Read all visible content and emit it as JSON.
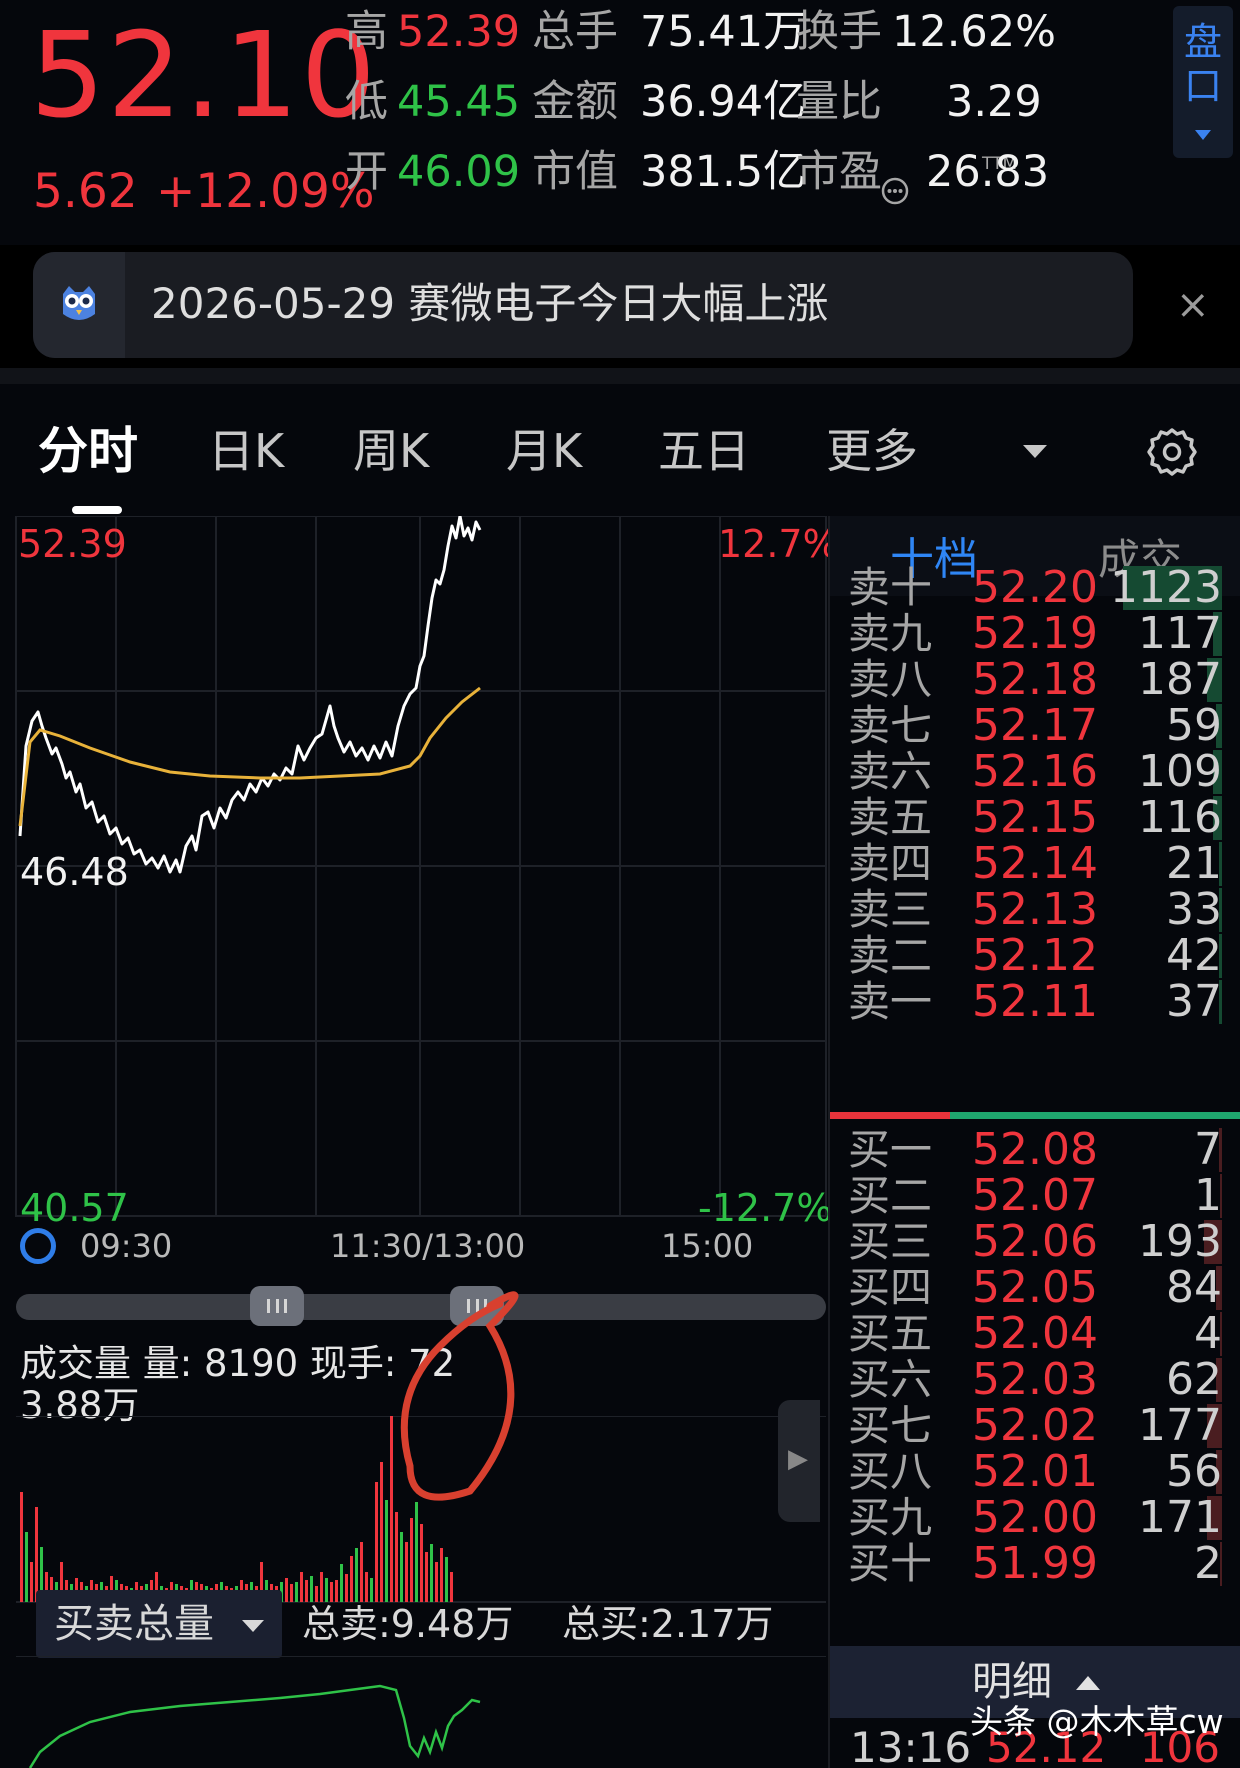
{
  "quote": {
    "price": "52.10",
    "change": "5.62",
    "change_pct": "+12.09%",
    "high_label": "高",
    "high": "52.39",
    "low_label": "低",
    "low": "45.45",
    "open_label": "开",
    "open": "46.09",
    "volume_label": "总手",
    "volume": "75.41万",
    "amount_label": "金额",
    "amount": "36.94亿",
    "mktcap_label": "市值",
    "mktcap": "381.5亿",
    "turnover_label": "换手",
    "turnover": "12.62%",
    "volratio_label": "量比",
    "volratio": "3.29",
    "pe_label": "市盈",
    "pe_superscript": "TTM",
    "pe": "26.83",
    "pankou_label": "盘口"
  },
  "news": {
    "text": "2026-05-29 赛微电子今日大幅上涨",
    "close": "×"
  },
  "tabs": [
    "分时",
    "日K",
    "周K",
    "月K",
    "五日",
    "更多"
  ],
  "chart": {
    "high_label": "52.39",
    "high_pct": "12.7%",
    "mid_label": "46.48",
    "low_label": "40.57",
    "low_pct": "-12.7%",
    "time_start": "09:30",
    "time_mid": "11:30/13:00",
    "time_end": "15:00",
    "volume_title": "成交量 量: 8190  现手: 72",
    "volume_max": "3.88万",
    "bs_selector": "买卖总量",
    "total_sell": "总卖:9.48万",
    "total_buy": "总买:2.17万"
  },
  "chart_data": {
    "type": "line",
    "x": [
      "09:30",
      "11:30/13:00",
      "15:00"
    ],
    "ylim": [
      40.57,
      52.39
    ],
    "series": []
  },
  "order_book": {
    "tab_ten": "十档",
    "tab_trades": "成交",
    "asks": [
      {
        "label": "卖十",
        "price": "52.20",
        "vol": "1123",
        "fill": 0.33
      },
      {
        "label": "卖九",
        "price": "52.19",
        "vol": "117",
        "fill": 0.03
      },
      {
        "label": "卖八",
        "price": "52.18",
        "vol": "187",
        "fill": 0.05
      },
      {
        "label": "卖七",
        "price": "52.17",
        "vol": "59",
        "fill": 0.02
      },
      {
        "label": "卖六",
        "price": "52.16",
        "vol": "109",
        "fill": 0.03
      },
      {
        "label": "卖五",
        "price": "52.15",
        "vol": "116",
        "fill": 0.03
      },
      {
        "label": "卖四",
        "price": "52.14",
        "vol": "21",
        "fill": 0.01
      },
      {
        "label": "卖三",
        "price": "52.13",
        "vol": "33",
        "fill": 0.01
      },
      {
        "label": "卖二",
        "price": "52.12",
        "vol": "42",
        "fill": 0.01
      },
      {
        "label": "卖一",
        "price": "52.11",
        "vol": "37",
        "fill": 0.01
      }
    ],
    "bids": [
      {
        "label": "买一",
        "price": "52.08",
        "vol": "7",
        "fill": 0.01
      },
      {
        "label": "买二",
        "price": "52.07",
        "vol": "1",
        "fill": 0.005
      },
      {
        "label": "买三",
        "price": "52.06",
        "vol": "193",
        "fill": 0.06
      },
      {
        "label": "买四",
        "price": "52.05",
        "vol": "84",
        "fill": 0.02
      },
      {
        "label": "买五",
        "price": "52.04",
        "vol": "4",
        "fill": 0.005
      },
      {
        "label": "买六",
        "price": "52.03",
        "vol": "62",
        "fill": 0.02
      },
      {
        "label": "买七",
        "price": "52.02",
        "vol": "177",
        "fill": 0.05
      },
      {
        "label": "买八",
        "price": "52.01",
        "vol": "56",
        "fill": 0.02
      },
      {
        "label": "买九",
        "price": "52.00",
        "vol": "171",
        "fill": 0.05
      },
      {
        "label": "买十",
        "price": "51.99",
        "vol": "2",
        "fill": 0.005
      }
    ],
    "detail_label": "明细",
    "last_trade": {
      "time": "13:16",
      "price": "52.12",
      "vol": "106"
    }
  },
  "watermark": "头条 @木木草cw",
  "colors": {
    "up": "#f0353d",
    "down": "#2fc248",
    "accent": "#2f86f5",
    "avg_line": "#e8b23a"
  }
}
